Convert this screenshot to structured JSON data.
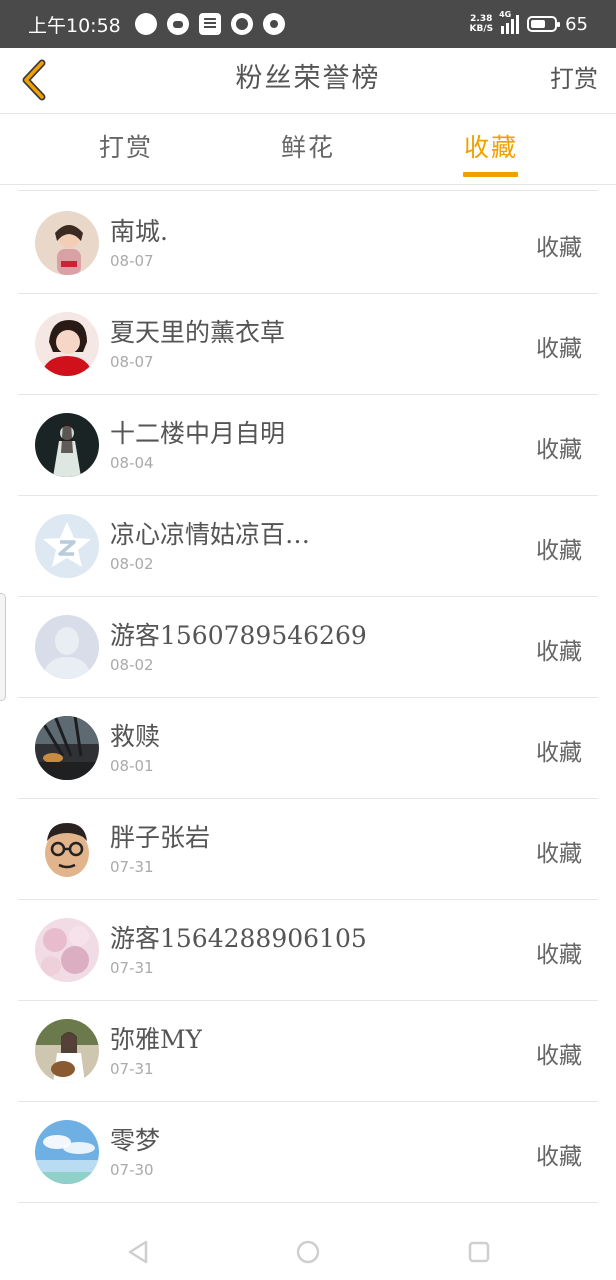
{
  "status_bar": {
    "time": "上午10:58",
    "net_speed_value": "2.38",
    "net_speed_unit": "KB/S",
    "network_type": "4G",
    "battery": "65",
    "battery_level": 0.65,
    "icons": [
      "bubble-icon",
      "wechat-icon",
      "list-icon",
      "qq-browser-icon",
      "uc-icon"
    ]
  },
  "header": {
    "back_icon": "chevron-left-icon",
    "title": "粉丝荣誉榜",
    "action": "打赏"
  },
  "tabs": [
    {
      "label": "打赏",
      "active": false
    },
    {
      "label": "鲜花",
      "active": false
    },
    {
      "label": "收藏",
      "active": true
    }
  ],
  "colors": {
    "accent": "#f0a000",
    "status_bar_bg": "#4a4a4a",
    "text": "#555555",
    "date": "#aaaaaa",
    "divider": "#e6e6e6"
  },
  "list": [
    {
      "name": "南城.",
      "date": "08-07",
      "action": "收藏",
      "avatar": "girl-photo-avatar"
    },
    {
      "name": "夏天里的薰衣草",
      "date": "08-07",
      "action": "收藏",
      "avatar": "woman-red-avatar"
    },
    {
      "name": "十二楼中月自明",
      "date": "08-04",
      "action": "收藏",
      "avatar": "dark-figure-avatar"
    },
    {
      "name": "凉心凉情姑凉百…",
      "date": "08-02",
      "action": "收藏",
      "avatar": "qq-star-avatar"
    },
    {
      "name": "游客1560789546269",
      "date": "08-02",
      "action": "收藏",
      "avatar": "default-person-avatar"
    },
    {
      "name": "救赎",
      "date": "08-01",
      "action": "收藏",
      "avatar": "night-scene-avatar"
    },
    {
      "name": "胖子张岩",
      "date": "07-31",
      "action": "收藏",
      "avatar": "cartoon-man-avatar"
    },
    {
      "name": "游客1564288906105",
      "date": "07-31",
      "action": "收藏",
      "avatar": "pink-blossom-avatar"
    },
    {
      "name": "弥雅MY",
      "date": "07-31",
      "action": "收藏",
      "avatar": "guitar-girl-avatar"
    },
    {
      "name": "零梦",
      "date": "07-30",
      "action": "收藏",
      "avatar": "sky-sea-avatar"
    }
  ],
  "nav": {
    "back": "triangle-back-icon",
    "home": "circle-home-icon",
    "recent": "square-recent-icon"
  }
}
